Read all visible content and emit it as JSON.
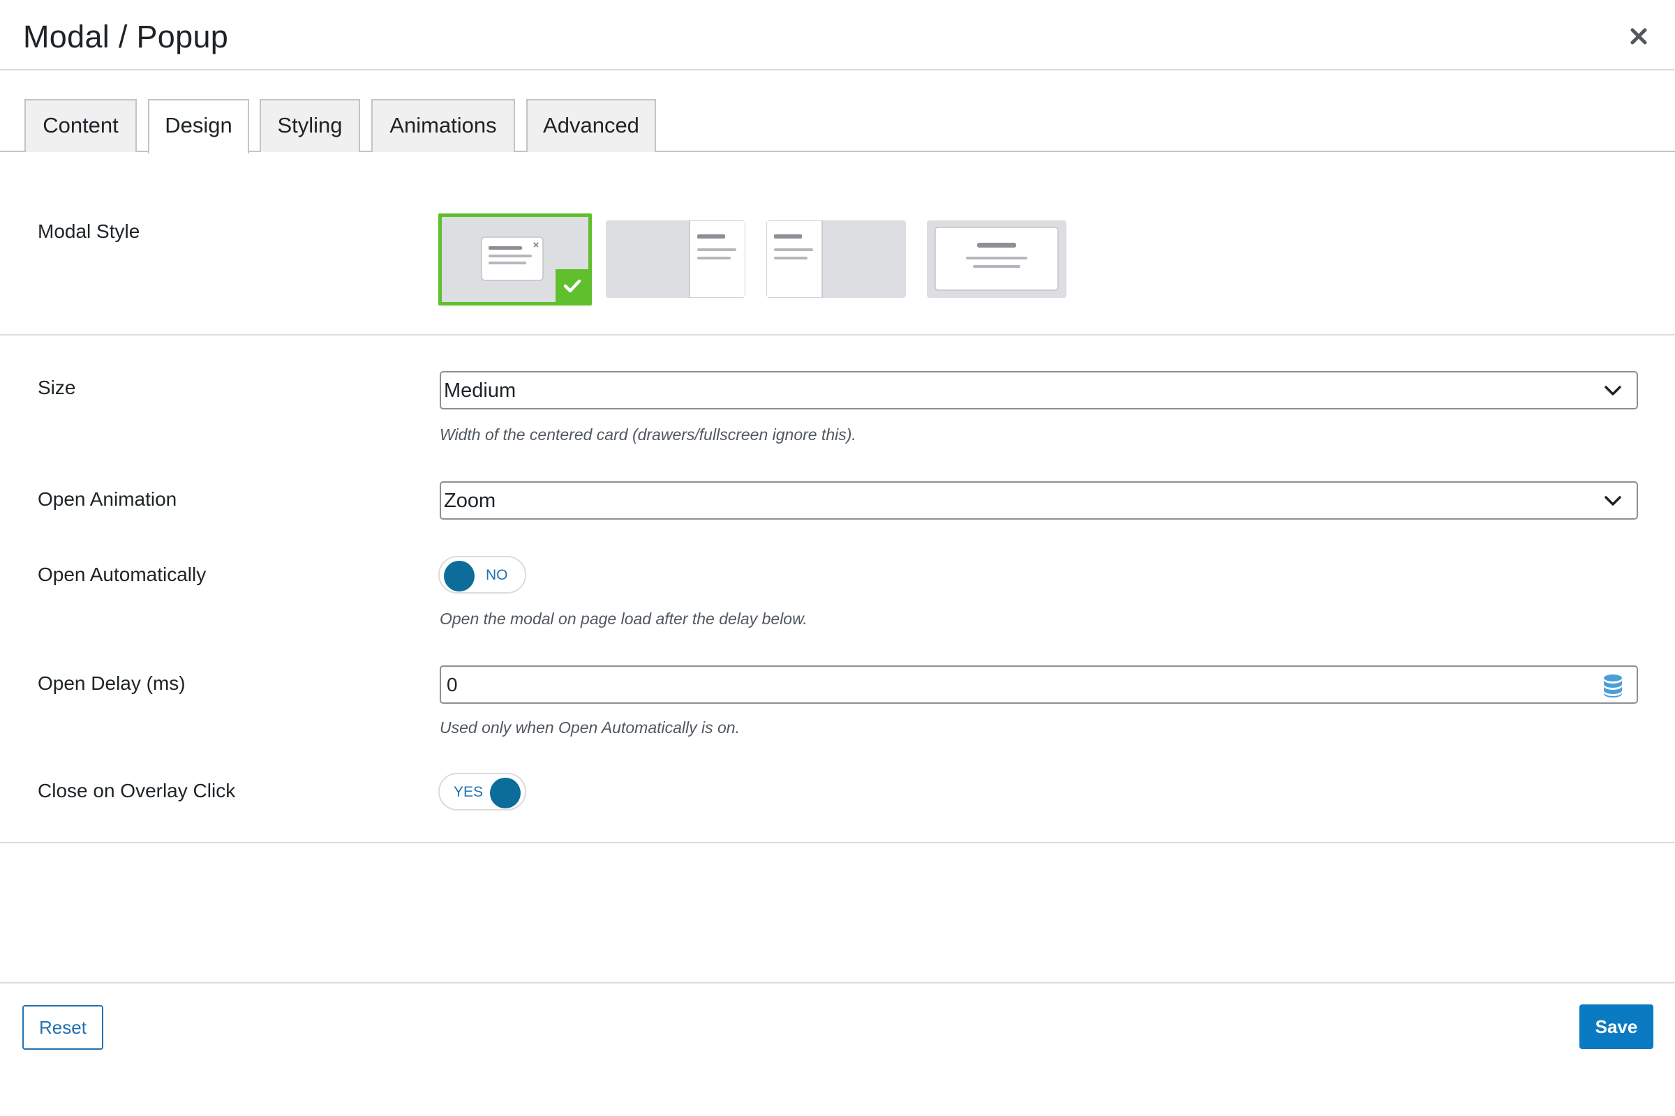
{
  "header": {
    "title": "Modal / Popup",
    "close_icon": "close-icon"
  },
  "tabs": [
    {
      "label": "Content",
      "active": false
    },
    {
      "label": "Design",
      "active": true
    },
    {
      "label": "Styling",
      "active": false
    },
    {
      "label": "Animations",
      "active": false
    },
    {
      "label": "Advanced",
      "active": false
    }
  ],
  "modal_style": {
    "label": "Modal Style",
    "options": [
      "centered-card",
      "drawer-right",
      "drawer-left",
      "fullscreen"
    ],
    "selected": "centered-card"
  },
  "size": {
    "label": "Size",
    "value": "Medium",
    "help": "Width of the centered card (drawers/fullscreen ignore this)."
  },
  "open_animation": {
    "label": "Open Animation",
    "value": "Zoom"
  },
  "open_automatically": {
    "label": "Open Automatically",
    "state": "NO",
    "help": "Open the modal on page load after the delay below."
  },
  "open_delay": {
    "label": "Open Delay (ms)",
    "value": "0",
    "help": "Used only when Open Automatically is on."
  },
  "close_on_overlay": {
    "label": "Close on Overlay Click",
    "state": "YES"
  },
  "footer": {
    "reset_label": "Reset",
    "save_label": "Save"
  },
  "colors": {
    "accent_blue": "#2271b1",
    "toggle_knob": "#0d6d9a",
    "selected_green": "#5fbf2d",
    "save_button": "#0a7bc2"
  }
}
